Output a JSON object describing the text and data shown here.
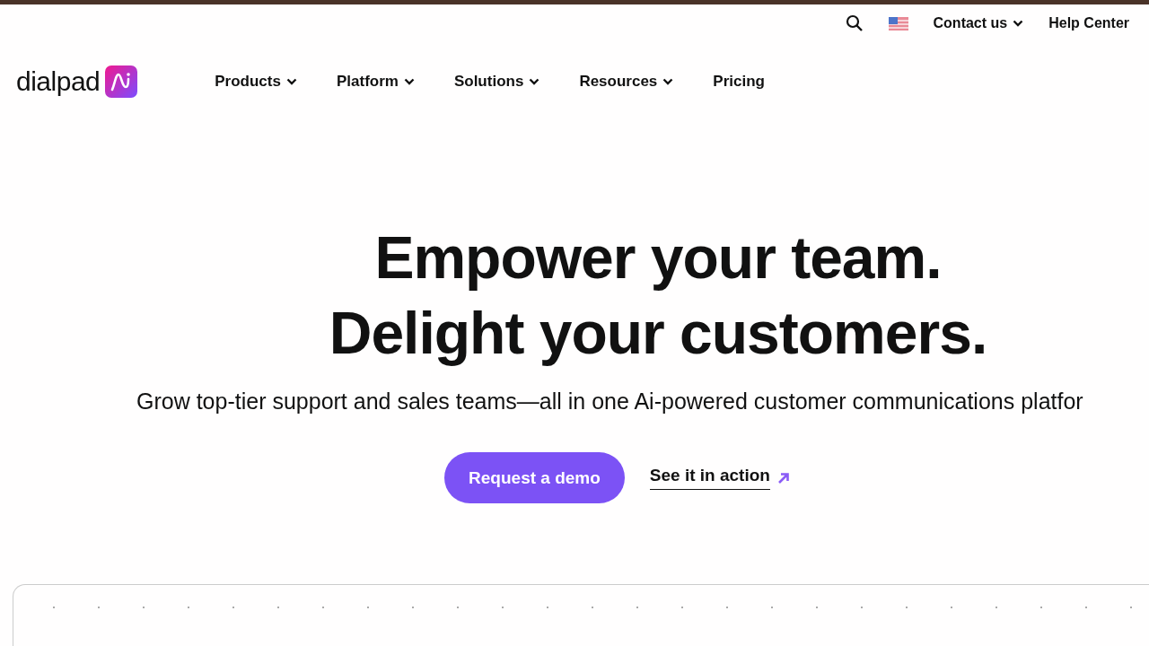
{
  "utility_bar": {
    "contact": "Contact us",
    "help": "Help Center"
  },
  "logo": {
    "wordmark": "dialpad"
  },
  "nav": [
    {
      "label": "Products",
      "dropdown": true
    },
    {
      "label": "Platform",
      "dropdown": true
    },
    {
      "label": "Solutions",
      "dropdown": true
    },
    {
      "label": "Resources",
      "dropdown": true
    },
    {
      "label": "Pricing",
      "dropdown": false
    }
  ],
  "hero": {
    "title_lines": [
      "Empower your team.",
      "Delight your customers."
    ],
    "subtitle": "Grow top-tier support and sales teams—all in one Ai-powered customer communications platfor",
    "primary_button": "Request a demo",
    "secondary_link": "See it in action"
  }
}
